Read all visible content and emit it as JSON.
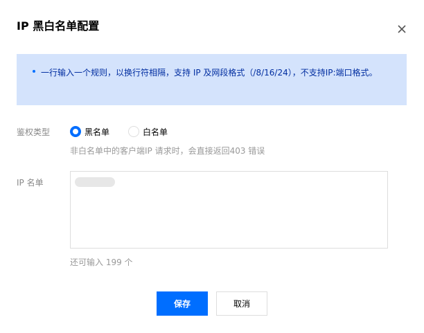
{
  "dialog": {
    "title": "IP 黑白名单配置",
    "close_icon": "close-icon"
  },
  "notice": {
    "text": "一行输入一个规则，以换行符相隔，支持 IP 及网段格式（/8/16/24），不支持IP:端口格式。",
    "bullet_color": "#006eff",
    "background": "#d4e3fc"
  },
  "auth_type": {
    "label": "鉴权类型",
    "options": [
      {
        "label": "黑名单",
        "checked": true
      },
      {
        "label": "白名单",
        "checked": false
      }
    ],
    "hint": "非白名单中的客户端IP 请求时，会直接返回403 错误"
  },
  "ip_list": {
    "label": "IP 名单",
    "value": "",
    "remaining_text": "还可输入 199 个"
  },
  "footer": {
    "save_label": "保存",
    "cancel_label": "取消"
  },
  "colors": {
    "accent": "#006eff",
    "border": "#dddddd"
  }
}
